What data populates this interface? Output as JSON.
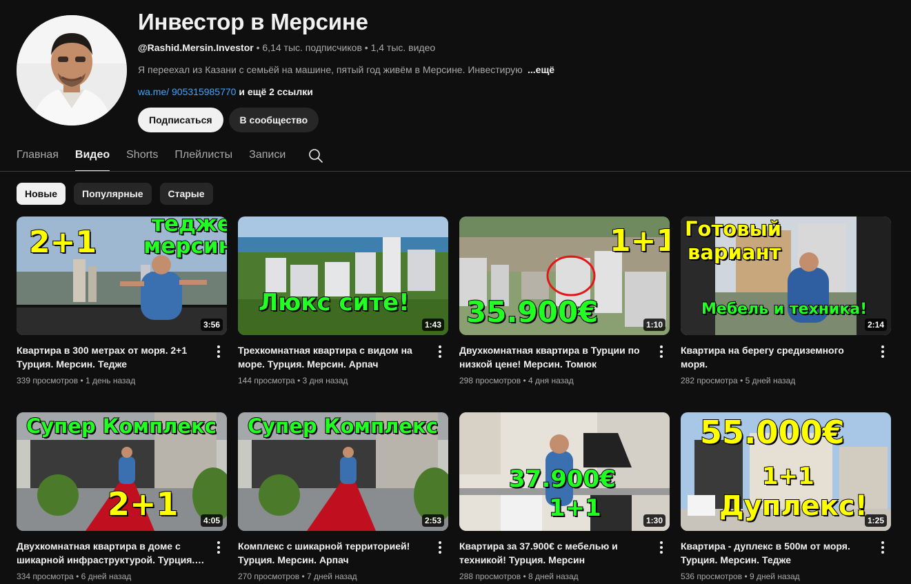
{
  "channel": {
    "title": "Инвестор в Мерсине",
    "handle": "@Rashid.Mersin.Investor",
    "subscribers": "6,14 тыс. подписчиков",
    "video_count": "1,4 тыс. видео",
    "separator": "•",
    "description": "Я переехал из Казани с семьёй на машине, пятый год живём в Мерсине. Инвестирую",
    "description_more": "...ещё",
    "link_text": "wa.me/ 905315985770",
    "more_links": "и ещё 2 ссылки",
    "subscribe_label": "Подписаться",
    "community_label": "В сообщество"
  },
  "tabs": [
    {
      "label": "Главная",
      "active": false
    },
    {
      "label": "Видео",
      "active": true
    },
    {
      "label": "Shorts",
      "active": false
    },
    {
      "label": "Плейлисты",
      "active": false
    },
    {
      "label": "Записи",
      "active": false
    }
  ],
  "chips": [
    {
      "label": "Новые",
      "active": true
    },
    {
      "label": "Популярные",
      "active": false
    },
    {
      "label": "Старые",
      "active": false
    }
  ],
  "videos": [
    {
      "title": "Квартира в 300 метрах от моря. 2+1 Турция. Мерсин. Тедже",
      "views": "339 просмотров",
      "age": "1 день назад",
      "duration": "3:56",
      "overlays": [
        "2+1",
        "тедже",
        "мерсин"
      ]
    },
    {
      "title": "Трехкомнатная квартира с видом на море. Турция. Мерсин. Арпач",
      "views": "144 просмотра",
      "age": "3 дня назад",
      "duration": "1:43",
      "overlays": [
        "Люкс сите!"
      ]
    },
    {
      "title": "Двухкомнатная квартира в Турции по низкой цене! Мерсин. Томюк",
      "views": "298 просмотров",
      "age": "4 дня назад",
      "duration": "1:10",
      "overlays": [
        "1+1",
        "35.900€"
      ]
    },
    {
      "title": "Квартира на берегу средиземного моря.",
      "views": "282 просмотра",
      "age": "5 дней назад",
      "duration": "2:14",
      "overlays": [
        "Готовый",
        "вариант",
        "Мебель и техника!"
      ]
    },
    {
      "title": "Двухкомнатная квартира в доме с шикарной инфраструктурой. Турция. Мерсин",
      "views": "334 просмотра",
      "age": "6 дней назад",
      "duration": "4:05",
      "overlays": [
        "Супер  Комплекс",
        "2+1"
      ]
    },
    {
      "title": "Комплекс с шикарной территорией! Турция. Мерсин. Арпач",
      "views": "270 просмотров",
      "age": "7 дней назад",
      "duration": "2:53",
      "overlays": [
        "Супер  Комплекс"
      ]
    },
    {
      "title": "Квартира за 37.900€ с мебелью и техникой! Турция. Мерсин",
      "views": "288 просмотров",
      "age": "8 дней назад",
      "duration": "1:30",
      "overlays": [
        "37.900€",
        "1+1"
      ]
    },
    {
      "title": "Квартира - дуплекс в 500м от моря. Турция. Мерсин. Тедже",
      "views": "536 просмотров",
      "age": "9 дней назад",
      "duration": "1:25",
      "overlays": [
        "55.000€",
        "1+1",
        "Дуплекс!"
      ]
    }
  ],
  "colors": {
    "background": "#0f0f0f",
    "link": "#3ea6ff",
    "overlay_yellow": "#ffff00",
    "overlay_green": "#22ff22"
  }
}
